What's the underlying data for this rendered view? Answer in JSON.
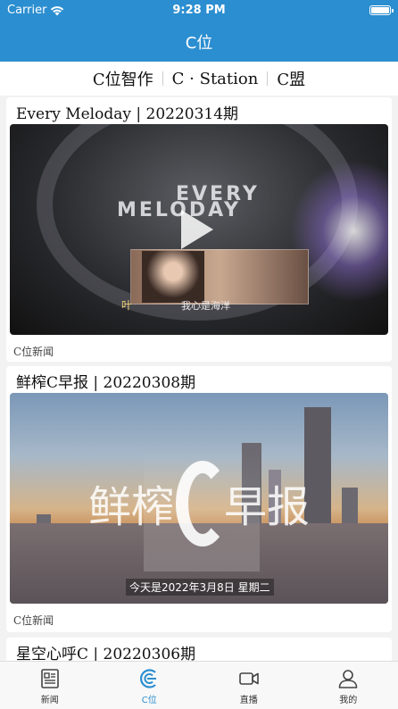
{
  "status_bar": {
    "carrier": "Carrier",
    "time": "9:28 PM",
    "wifi_icon": "wifi-icon",
    "battery_icon": "battery-icon"
  },
  "nav": {
    "title": "C位"
  },
  "segments": [
    "C位智作",
    "C · Station",
    "C盟"
  ],
  "feed": [
    {
      "title": "Every Meloday | 20220314期",
      "source": "C位新闻",
      "thumb_text": [
        "EVERY",
        "MELODAY"
      ],
      "thumb_caption": [
        "叶",
        "我心是海洋"
      ],
      "play_icon": "play-icon"
    },
    {
      "title": "鲜榨C早报 | 20220308期",
      "source": "C位新闻",
      "thumb_text": [
        "鲜榨",
        "早报"
      ],
      "thumb_caption": [
        "今天是2022年3月8日 星期二"
      ]
    },
    {
      "title": "星空心呼C | 20220306期"
    }
  ],
  "tabbar": [
    {
      "label": "新闻",
      "icon": "newspaper-icon",
      "active": false
    },
    {
      "label": "C位",
      "icon": "c-position-icon",
      "active": true
    },
    {
      "label": "直播",
      "icon": "video-camera-icon",
      "active": false
    },
    {
      "label": "我的",
      "icon": "person-icon",
      "active": false
    }
  ],
  "colors": {
    "primary": "#2b8ed0",
    "background": "#f2f2f2"
  }
}
